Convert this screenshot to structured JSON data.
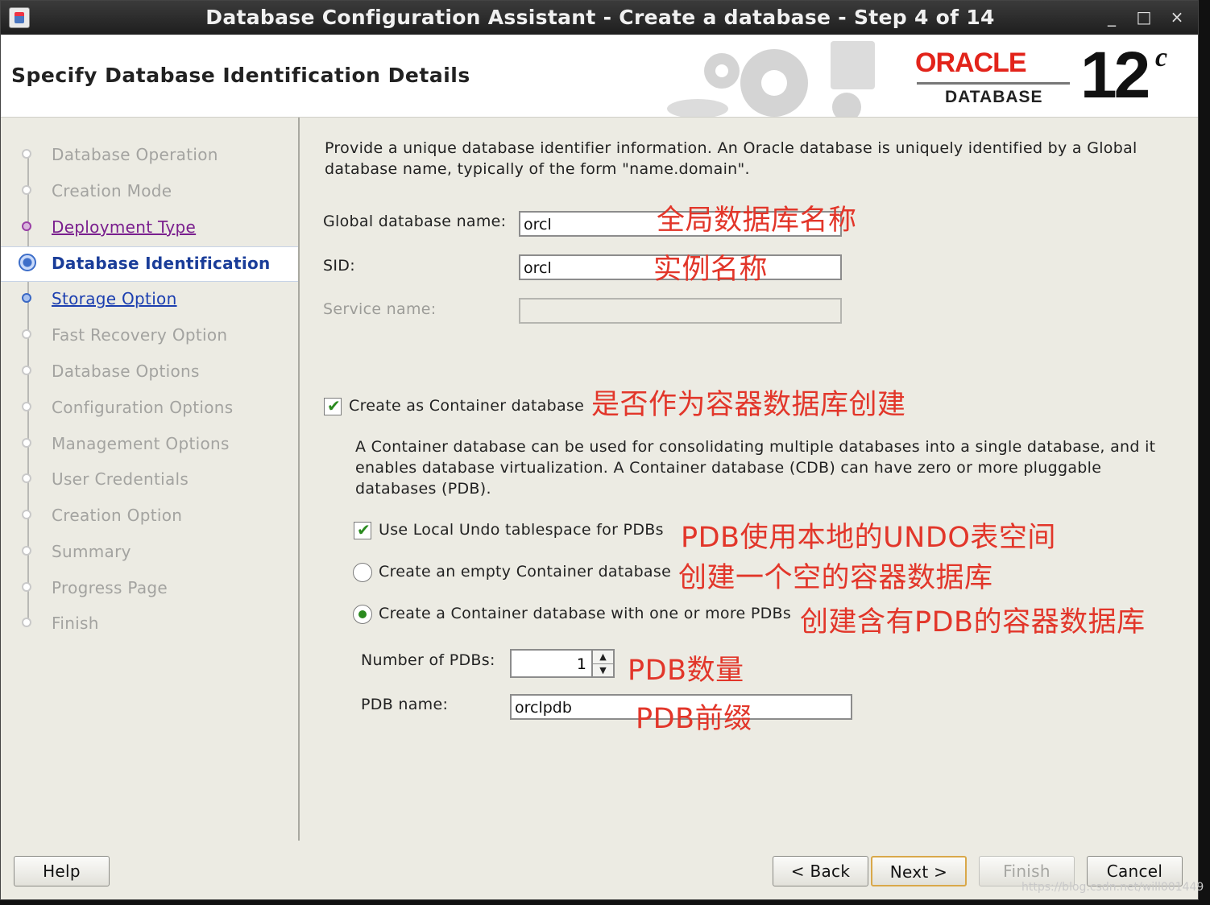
{
  "window": {
    "title": "Database Configuration Assistant - Create a database - Step 4 of 14",
    "controls": {
      "minimize": "_",
      "maximize": "□",
      "close": "×"
    }
  },
  "header": {
    "page_title": "Specify Database Identification Details",
    "logo": {
      "brand": "ORACLE",
      "product": "DATABASE",
      "version": "12",
      "version_suffix": "c"
    }
  },
  "steps": [
    {
      "label": "Database Operation",
      "state": "disabled"
    },
    {
      "label": "Creation Mode",
      "state": "disabled"
    },
    {
      "label": "Deployment Type",
      "state": "visited"
    },
    {
      "label": "Database Identification",
      "state": "current"
    },
    {
      "label": "Storage Option",
      "state": "next"
    },
    {
      "label": "Fast Recovery Option",
      "state": "disabled"
    },
    {
      "label": "Database Options",
      "state": "disabled"
    },
    {
      "label": "Configuration Options",
      "state": "disabled"
    },
    {
      "label": "Management Options",
      "state": "disabled"
    },
    {
      "label": "User Credentials",
      "state": "disabled"
    },
    {
      "label": "Creation Option",
      "state": "disabled"
    },
    {
      "label": "Summary",
      "state": "disabled"
    },
    {
      "label": "Progress Page",
      "state": "disabled"
    },
    {
      "label": "Finish",
      "state": "disabled"
    }
  ],
  "content": {
    "intro_line1": "Provide a unique database identifier information. An Oracle database is uniquely identified by a Global",
    "intro_line2": "database name, typically of the form \"name.domain\".",
    "global_db_name_label": "Global database name:",
    "global_db_name_value": "orcl",
    "sid_label": "SID:",
    "sid_value": "orcl",
    "service_name_label": "Service name:",
    "service_name_value": "",
    "container_label": "Create as Container database",
    "container_checked": true,
    "container_desc_line1": "A Container database can be used for consolidating multiple databases into a single database, and it",
    "container_desc_line2": "enables database virtualization. A Container database (CDB) can have zero or more pluggable",
    "container_desc_line3": "databases (PDB).",
    "local_undo_label": "Use Local Undo tablespace for PDBs",
    "local_undo_checked": true,
    "empty_cdb_label": "Create an empty Container database",
    "with_pdbs_label": "Create a Container database with one or more PDBs",
    "selected_option": "with_pdbs",
    "num_pdbs_label": "Number of PDBs:",
    "num_pdbs_value": "1",
    "pdb_name_label": "PDB name:",
    "pdb_name_value": "orclpdb"
  },
  "annotations": {
    "global_db_name": "全局数据库名称",
    "sid": "实例名称",
    "container": "是否作为容器数据库创建",
    "local_undo": "PDB使用本地的UNDO表空间",
    "empty_cdb": "创建一个空的容器数据库",
    "with_pdbs": "创建含有PDB的容器数据库",
    "num_pdbs": "PDB数量",
    "pdb_name": "PDB前缀"
  },
  "footer": {
    "help": "Help",
    "back": "< Back",
    "next": "Next >",
    "finish": "Finish",
    "cancel": "Cancel"
  },
  "watermark": "https://blog.csdn.net/will001449",
  "colors": {
    "annotation": "#e2362a",
    "oracle_red": "#e2231a",
    "check_green": "#2a8a1e",
    "current_step": "#1a3d99"
  }
}
